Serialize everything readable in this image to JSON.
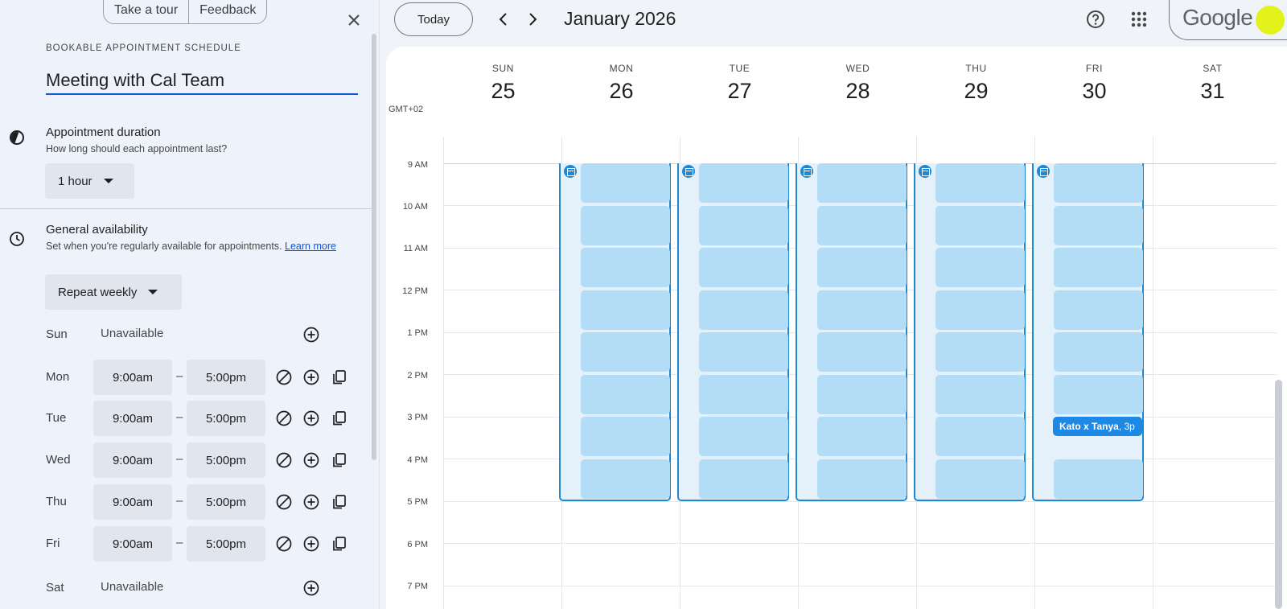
{
  "panel": {
    "take_tour": "Take a tour",
    "feedback": "Feedback",
    "kicker": "BOOKABLE APPOINTMENT SCHEDULE",
    "title_value": "Meeting with Cal Team",
    "duration": {
      "title": "Appointment duration",
      "subtitle": "How long should each appointment last?",
      "value": "1 hour"
    },
    "availability": {
      "title": "General availability",
      "subtitle": "Set when you're regularly available for appointments.",
      "learn_more": "Learn more",
      "repeat": "Repeat weekly"
    },
    "days": [
      {
        "name": "Sun",
        "status": "Unavailable"
      },
      {
        "name": "Mon",
        "start": "9:00am",
        "end": "5:00pm"
      },
      {
        "name": "Tue",
        "start": "9:00am",
        "end": "5:00pm"
      },
      {
        "name": "Wed",
        "start": "9:00am",
        "end": "5:00pm"
      },
      {
        "name": "Thu",
        "start": "9:00am",
        "end": "5:00pm"
      },
      {
        "name": "Fri",
        "start": "9:00am",
        "end": "5:00pm"
      },
      {
        "name": "Sat",
        "status": "Unavailable"
      }
    ],
    "dash": "–"
  },
  "header": {
    "today": "Today",
    "month": "January 2026",
    "brand": "Google"
  },
  "calendar": {
    "timezone": "GMT+02",
    "columns": [
      {
        "dow": "SUN",
        "date": "25"
      },
      {
        "dow": "MON",
        "date": "26"
      },
      {
        "dow": "TUE",
        "date": "27"
      },
      {
        "dow": "WED",
        "date": "28"
      },
      {
        "dow": "THU",
        "date": "29"
      },
      {
        "dow": "FRI",
        "date": "30"
      },
      {
        "dow": "SAT",
        "date": "31"
      }
    ],
    "hours": [
      "9 AM",
      "10 AM",
      "11 AM",
      "12 PM",
      "1 PM",
      "2 PM",
      "3 PM",
      "4 PM",
      "5 PM",
      "6 PM",
      "7 PM"
    ],
    "event": {
      "title": "Kato x Tanya",
      "time": ", 3p"
    }
  },
  "colors": {
    "accent": "#0b57d0",
    "slot_fill": "#b3dcf6",
    "slot_border": "#1e88d2",
    "event": "#1e88e5",
    "avatar": "#e3f21b"
  }
}
